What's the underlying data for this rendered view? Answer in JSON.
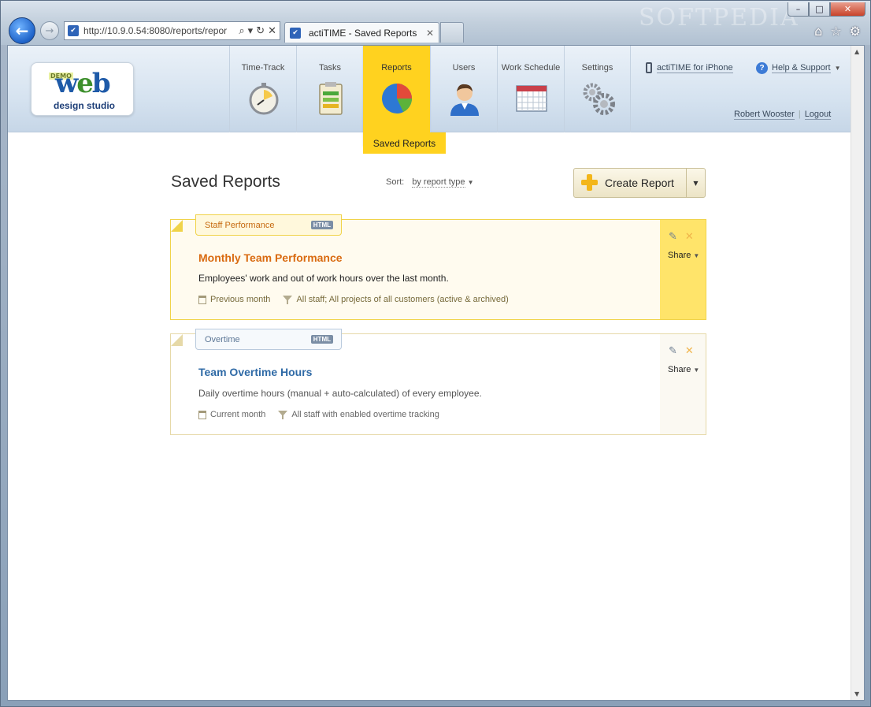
{
  "browser": {
    "address": "http://10.9.0.54:8080/reports/repor",
    "address_host": "10.9.0.54",
    "tab_title": "actiTIME - Saved Reports",
    "watermark": "SOFTPEDIA"
  },
  "logo": {
    "demo": "DEMO",
    "web": "web",
    "studio": "design studio"
  },
  "nav": {
    "items": [
      {
        "label": "Time-Track",
        "icon": "stopwatch-icon"
      },
      {
        "label": "Tasks",
        "icon": "clipboard-icon"
      },
      {
        "label": "Reports",
        "icon": "pie-chart-icon"
      },
      {
        "label": "Users",
        "icon": "user-icon"
      },
      {
        "label": "Work Schedule",
        "icon": "calendar-icon"
      },
      {
        "label": "Settings",
        "icon": "gears-icon"
      }
    ],
    "active_subnav": "Saved Reports"
  },
  "header_links": {
    "iphone": "actiTIME for iPhone",
    "help": "Help & Support",
    "user": "Robert Wooster",
    "logout": "Logout",
    "separator": "|"
  },
  "page": {
    "title": "Saved Reports",
    "sort_label": "Sort:",
    "sort_value": "by report type",
    "create_button": "Create Report"
  },
  "reports": [
    {
      "category": "Staff Performance",
      "format": "HTML",
      "title": "Monthly Team Performance",
      "description": "Employees' work and out of work hours over the last month.",
      "period": "Previous month",
      "filter": "All staff; All projects of all customers (active & archived)",
      "share": "Share"
    },
    {
      "category": "Overtime",
      "format": "HTML",
      "title": "Team Overtime Hours",
      "description": "Daily overtime hours (manual + auto-calculated) of every employee.",
      "period": "Current month",
      "filter": "All staff with enabled overtime tracking",
      "share": "Share"
    }
  ],
  "colors": {
    "accent_yellow": "#ffd21f",
    "report_title_orange": "#d96a10",
    "report_title_blue": "#2f6aa6"
  }
}
